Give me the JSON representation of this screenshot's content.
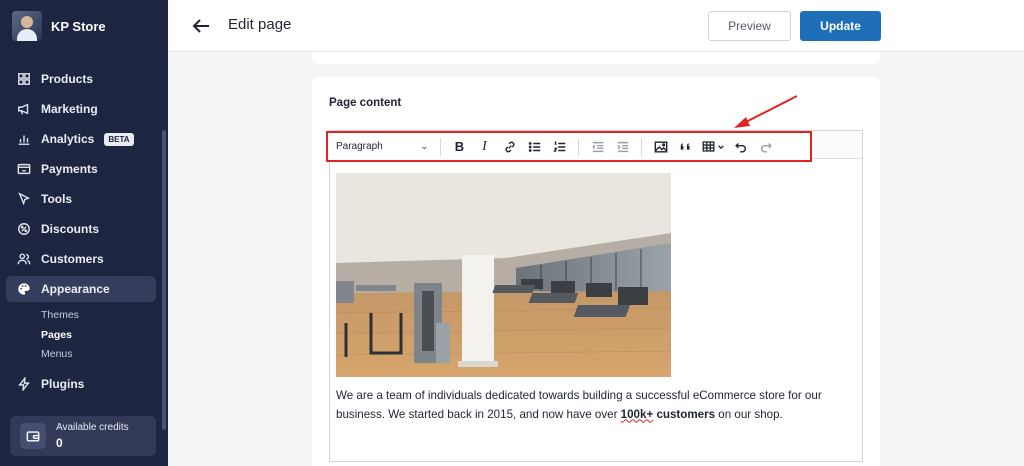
{
  "sidebar": {
    "store_name": "KP Store",
    "items": [
      {
        "label": "Products",
        "icon": "grid-icon"
      },
      {
        "label": "Marketing",
        "icon": "megaphone-icon"
      },
      {
        "label": "Analytics",
        "icon": "bar-chart-icon",
        "badge": "BETA"
      },
      {
        "label": "Payments",
        "icon": "payment-icon"
      },
      {
        "label": "Tools",
        "icon": "cursor-icon"
      },
      {
        "label": "Discounts",
        "icon": "discount-icon"
      },
      {
        "label": "Customers",
        "icon": "users-icon"
      },
      {
        "label": "Appearance",
        "icon": "palette-icon",
        "active": true
      }
    ],
    "subitems": [
      {
        "label": "Themes"
      },
      {
        "label": "Pages",
        "current": true
      },
      {
        "label": "Menus"
      }
    ],
    "plugins_label": "Plugins",
    "credits": {
      "label": "Available credits",
      "value": "0"
    }
  },
  "header": {
    "title": "Edit page",
    "preview_label": "Preview",
    "update_label": "Update"
  },
  "content": {
    "section_label": "Page content",
    "toolbar": {
      "block_format": "Paragraph",
      "buttons": [
        "bold-icon",
        "italic-icon",
        "link-icon",
        "bulleted-list-icon",
        "numbered-list-icon",
        "outdent-icon",
        "indent-icon",
        "image-icon",
        "blockquote-icon",
        "table-icon",
        "undo-icon",
        "redo-icon"
      ]
    },
    "body_text_1": "We are a team of individuals dedicated towards building a successful eCommerce store for our business. We started back in 2015, and now have over ",
    "body_bold_1": "100k+",
    "body_bold_2": " customers",
    "body_text_2": " on our shop."
  },
  "colors": {
    "sidebar_bg": "#1e2540",
    "accent": "#1f6fb8",
    "annotation_red": "#e02424"
  }
}
